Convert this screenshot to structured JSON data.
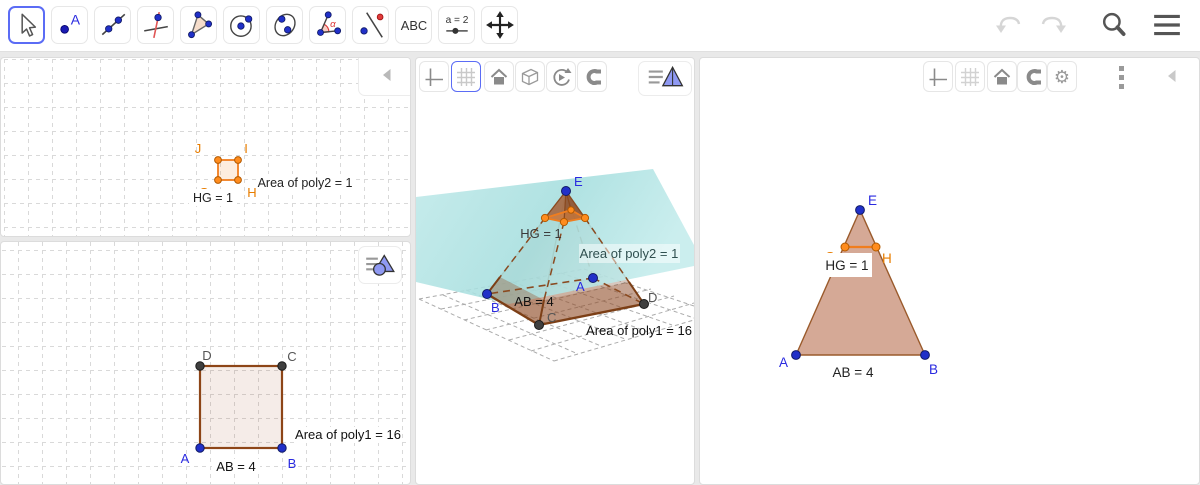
{
  "colors": {
    "accent_selected": "#5b6cf5",
    "point_blue": "#2130c8",
    "label_blue": "#2a2ae0",
    "point_orange": "#ff8c1e",
    "label_orange": "#e87d00",
    "point_dark": "#3f3f3f",
    "edge_brown": "#8a4a20",
    "square_fill": "#f5e9e4",
    "triangle_fill": "#d5a996",
    "plane_teal": "#aee0e0",
    "grid_gray": "#d9d9d9"
  },
  "toolbar": {
    "tools": [
      {
        "name": "move-select",
        "selected": true
      },
      {
        "name": "point",
        "glyph": "A"
      },
      {
        "name": "line-through-two-points"
      },
      {
        "name": "perpendicular-line"
      },
      {
        "name": "polygon"
      },
      {
        "name": "circle-with-center-through-point"
      },
      {
        "name": "conic-through-points"
      },
      {
        "name": "angle",
        "glyph": "α"
      },
      {
        "name": "reflect-about-line"
      },
      {
        "name": "text",
        "glyph": "ABC"
      },
      {
        "name": "slider",
        "glyph": "a = 2"
      },
      {
        "name": "move-graphics-view"
      }
    ],
    "actions": [
      "undo",
      "redo",
      "search",
      "menu"
    ]
  },
  "views": {
    "g1": {
      "name": "graphics-small-square",
      "toolbar_icons": [
        "collapse"
      ],
      "labels": {
        "J": "J",
        "I": "I",
        "H": "H",
        "G": "G"
      },
      "texts": {
        "hg": "HG = 1",
        "area": "Area of poly2 = 1"
      }
    },
    "g2": {
      "name": "graphics-big-square",
      "toolbar_icons": [
        "style-bar"
      ],
      "labels": {
        "A": "A",
        "B": "B",
        "C": "C",
        "D": "D"
      },
      "texts": {
        "ab": "AB = 4",
        "area": "Area of poly1 = 16"
      }
    },
    "g3d": {
      "name": "graphics-3d-pyramid",
      "toolbar_icons": [
        "axes",
        "grid",
        "home",
        "cube",
        "rotate-view",
        "snap-magnet",
        "style-bar"
      ],
      "labels": {
        "A": "A",
        "B": "B",
        "C": "C",
        "D": "D",
        "E": "E"
      },
      "texts": {
        "hg": "HG = 1",
        "ab": "AB = 4",
        "area2": "Area of poly2 = 1",
        "area1": "Area of poly1 = 16"
      }
    },
    "g4": {
      "name": "graphics-cross-section-triangle",
      "toolbar_icons": [
        "axes",
        "grid",
        "home",
        "snap-magnet",
        "settings",
        "more",
        "collapse"
      ],
      "labels": {
        "A": "A",
        "B": "B",
        "E": "E",
        "G": "G",
        "H": "H"
      },
      "texts": {
        "hg": "HG = 1",
        "ab": "AB = 4"
      }
    }
  }
}
